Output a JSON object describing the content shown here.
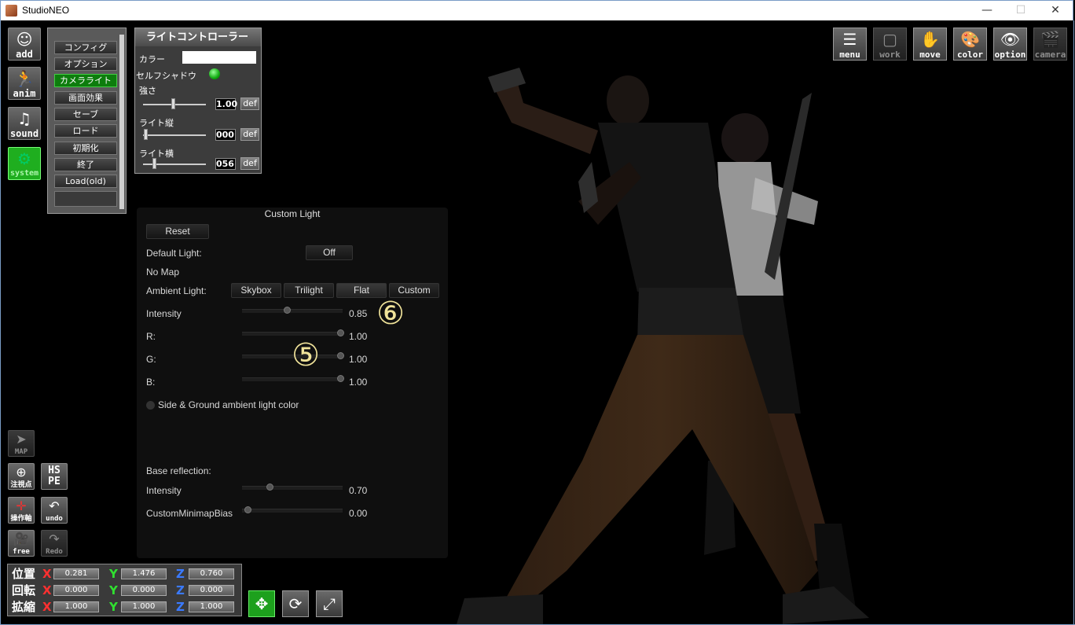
{
  "window": {
    "title": "StudioNEO",
    "minimize": "—",
    "maximize": "☐",
    "close": "✕"
  },
  "left_tools": [
    {
      "label": "add",
      "glyph": "☺"
    },
    {
      "label": "anim",
      "glyph": "🏃"
    },
    {
      "label": "sound",
      "glyph": "♫"
    },
    {
      "label": "system",
      "glyph": "⚙"
    }
  ],
  "system_menu": [
    "コンフィグ",
    "オプション",
    "カメラライト",
    "画面効果",
    "セーブ",
    "ロード",
    "初期化",
    "終了",
    "Load(old)"
  ],
  "system_menu_active": "カメラライト",
  "light_controller": {
    "title": "ライトコントローラー",
    "color_label": "カラー",
    "color_value": "#ffffff",
    "self_shadow_label": "セルフシャドウ",
    "strength_label": "強さ",
    "strength_value": "1.00",
    "vertical_label": "ライト縦",
    "vertical_value": "000",
    "horizontal_label": "ライト横",
    "horizontal_value": "056",
    "def_label": "def"
  },
  "custom_light": {
    "title": "Custom Light",
    "reset": "Reset",
    "default_light_label": "Default Light:",
    "default_light_value": "Off",
    "no_map": "No Map",
    "ambient_label": "Ambient Light:",
    "ambient_options": [
      "Skybox",
      "Trilight",
      "Flat",
      "Custom"
    ],
    "ambient_selected": "Flat",
    "intensity_label": "Intensity",
    "intensity_value": "0.85",
    "r_label": "R:",
    "r_value": "1.00",
    "g_label": "G:",
    "g_value": "1.00",
    "b_label": "B:",
    "b_value": "1.00",
    "side_ground_label": "Side & Ground ambient light color",
    "base_reflection_label": "Base reflection:",
    "base_intensity_label": "Intensity",
    "base_intensity_value": "0.70",
    "minimap_label": "CustomMinimapBias",
    "minimap_value": "0.00"
  },
  "annotations": {
    "five": "⑤",
    "six": "⑥"
  },
  "right_tools": [
    {
      "label": "menu",
      "glyph": "☰"
    },
    {
      "label": "work",
      "glyph": "▢"
    },
    {
      "label": "move",
      "glyph": "✋"
    },
    {
      "label": "color",
      "glyph": "🎨"
    },
    {
      "label": "option",
      "glyph": "👁"
    },
    {
      "label": "camera",
      "glyph": "🎬"
    }
  ],
  "small_tools": [
    {
      "label": "MAP",
      "glyph": "➤"
    },
    {
      "label": "注視点",
      "glyph": "⊕"
    },
    {
      "label": "HS PE",
      "glyph": ""
    },
    {
      "label": "操作軸",
      "glyph": "✛"
    },
    {
      "label": "undo",
      "glyph": "↶"
    },
    {
      "label": "free",
      "glyph": "🎥"
    },
    {
      "label": "Redo",
      "glyph": "↷"
    }
  ],
  "transform": {
    "position_label": "位置",
    "rotation_label": "回転",
    "scale_label": "拡縮",
    "x": "X",
    "y": "Y",
    "z": "Z",
    "position": [
      "0.281",
      "1.476",
      "0.760"
    ],
    "rotation": [
      "0.000",
      "0.000",
      "0.000"
    ],
    "scale": [
      "1.000",
      "1.000",
      "1.000"
    ]
  },
  "colors": {
    "accent_green": "#1fae1f",
    "axis_x": "#ff3030",
    "axis_y": "#30e030",
    "axis_z": "#3a7aff",
    "annotation": "#f0e39a"
  }
}
